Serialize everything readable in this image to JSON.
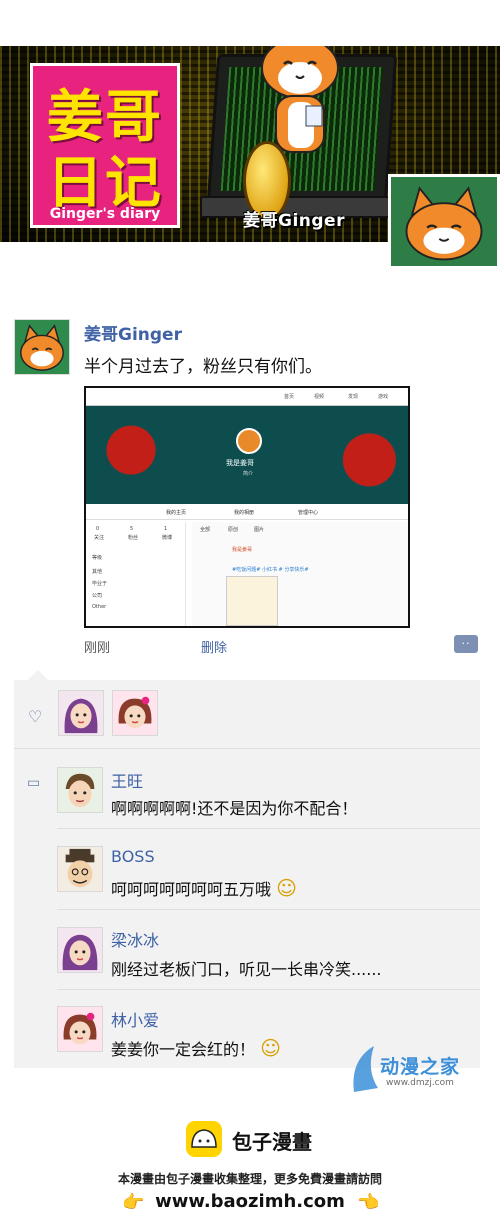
{
  "banner": {
    "logo_line1": "姜哥",
    "logo_line2": "日记",
    "logo_sub": "Ginger's diary",
    "name_label": "姜哥Ginger"
  },
  "post": {
    "author": "姜哥Ginger",
    "text": "半个月过去了，粉丝只有你们。",
    "time": "刚刚",
    "delete": "删除",
    "comment_glyph": "··",
    "screenshot": {
      "nav": [
        "首页",
        "视频",
        "发现",
        "游戏"
      ],
      "profile_name": "我是姜哥",
      "profile_sub": "简介",
      "tabs": [
        "我的主页",
        "我的相册",
        "管理中心"
      ],
      "counts": [
        {
          "n": "0",
          "l": "关注"
        },
        {
          "n": "5",
          "l": "粉丝"
        },
        {
          "n": "1",
          "l": "微博"
        }
      ],
      "left_items": [
        "等级",
        "其他",
        "毕业于",
        "公司",
        "Other"
      ],
      "feed_tabs": [
        "全部",
        "原创",
        "图片"
      ],
      "feed_author": "我是姜哥",
      "feed_text": "#吃饭问题# 小红书 # 分享快乐#"
    }
  },
  "interactions": {
    "like_icon": "♡",
    "comment_icon": "▭",
    "comments": [
      {
        "name": "王旺",
        "text": "啊啊啊啊啊!还不是因为你不配合！",
        "emoji": ""
      },
      {
        "name": "BOSS",
        "text": "呵呵呵呵呵呵呵五万哦",
        "emoji": "☺"
      },
      {
        "name": "梁冰冰",
        "text": "刚经过老板门口，听见一长串冷笑......",
        "emoji": ""
      },
      {
        "name": "林小爱",
        "text": "姜姜你一定会红的！",
        "emoji": "☺"
      }
    ]
  },
  "watermark": {
    "text": "动漫之家",
    "url": "www.dmzj.com"
  },
  "footer": {
    "brand": "包子漫畫",
    "note": "本漫畫由包子漫畫收集整理，更多免費漫畫請訪問",
    "url": "www.baozimh.com",
    "hand_icon": "👉"
  },
  "colors": {
    "link": "#3f62a5",
    "banner_pink": "#e8237f",
    "banner_yellow": "#ffe400",
    "panel_bg": "#f2f2f3",
    "baozi_yellow": "#ffd400"
  }
}
